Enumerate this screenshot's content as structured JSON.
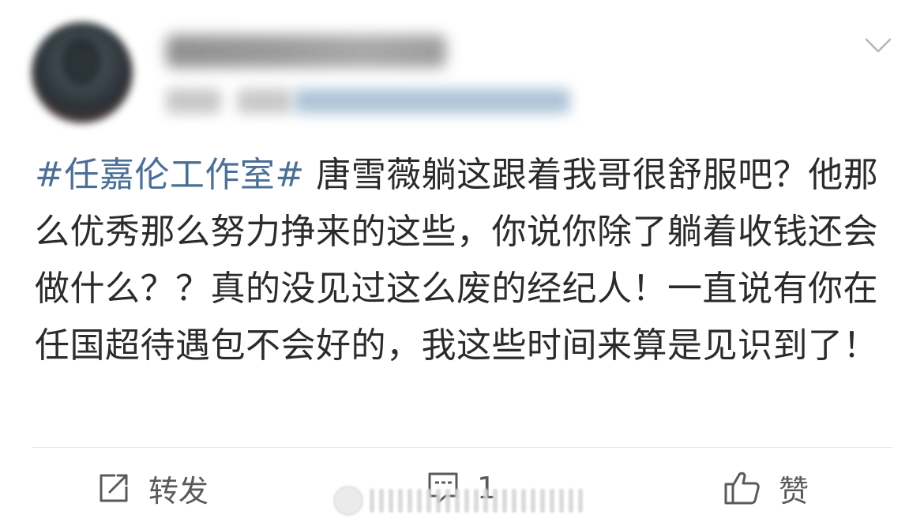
{
  "post": {
    "hashtag": "#任嘉伦工作室#",
    "text": " 唐雪薇躺这跟着我哥很舒服吧？他那么优秀那么努力挣来的这些，你说你除了躺着收钱还会做什么？？真的没见过这么废的经纪人！一直说有你在任国超待遇包不会好的，我这些时间来算是见识到了！"
  },
  "actions": {
    "repost_label": "转发",
    "comment_count": "1",
    "like_label": "赞"
  },
  "icons": {
    "repost": "edit-share-icon",
    "comment": "comment-icon",
    "like": "thumbs-up-icon",
    "menu": "chevron-down-icon"
  },
  "colors": {
    "hashtag": "#4b6f96",
    "text": "#2b2b2b",
    "action": "#5a5a5a"
  }
}
